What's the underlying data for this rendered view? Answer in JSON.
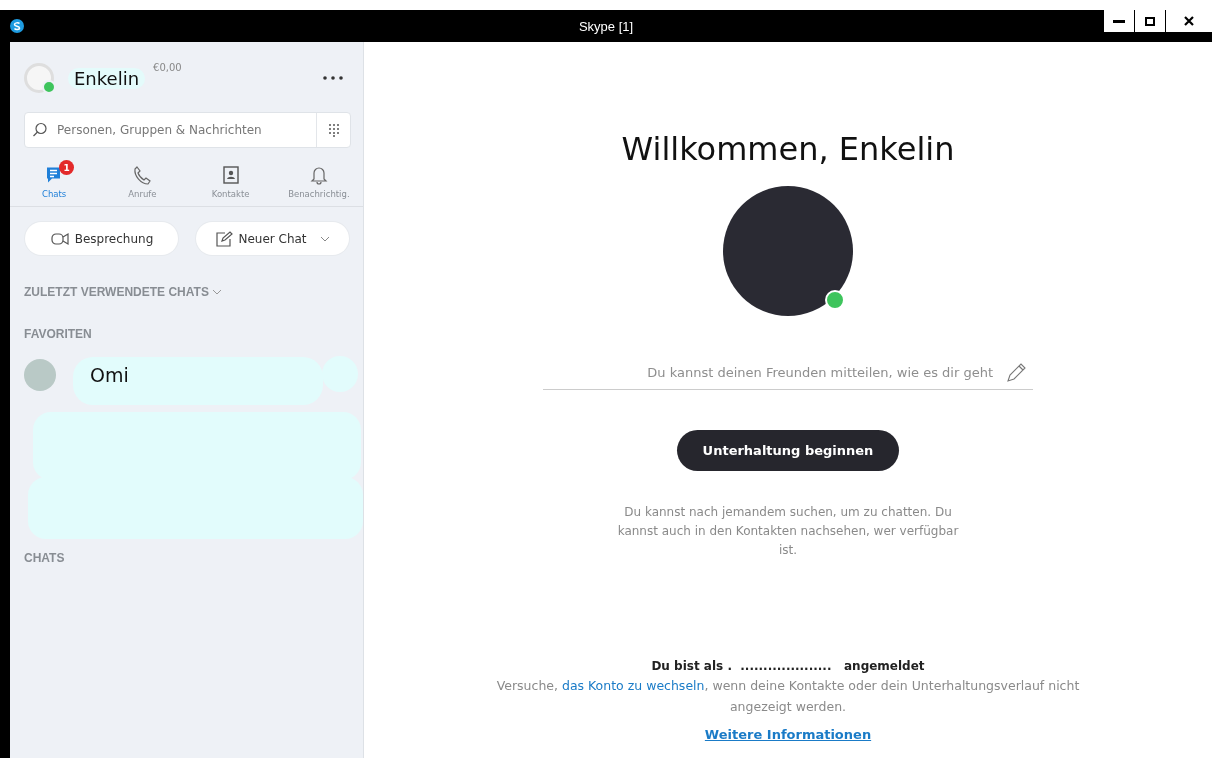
{
  "window": {
    "title": "Skype [1]"
  },
  "profile": {
    "name": "Enkelin",
    "credit": "€0,00",
    "online": true
  },
  "search": {
    "placeholder": "Personen, Gruppen & Nachrichten"
  },
  "tabs": [
    {
      "label": "Chats",
      "selected": true,
      "badge": "1"
    },
    {
      "label": "Anrufe",
      "selected": false
    },
    {
      "label": "Kontakte",
      "selected": false
    },
    {
      "label": "Benachrichtig.",
      "selected": false
    }
  ],
  "actions": [
    {
      "label": "Besprechung",
      "dropdown": false
    },
    {
      "label": "Neuer Chat",
      "dropdown": true
    }
  ],
  "sections": [
    {
      "title": "ZULETZT VERWENDETE CHATS",
      "expandable": true
    },
    {
      "title": "FAVORITEN",
      "expandable": false,
      "contacts": [
        {
          "name": "Omi"
        }
      ]
    },
    {
      "title": "CHATS",
      "expandable": false
    }
  ],
  "welcome": {
    "title": "Willkommen, Enkelin",
    "online": true,
    "mood_placeholder": "Du kannst deinen Freunden mitteilen, wie es dir geht",
    "button": "Unterhaltung beginnen",
    "hint": "Du kannst nach jemandem suchen, um zu chatten. Du kannst auch in den Kontakten nachsehen, wer verfügbar ist.",
    "signed_in": "Du bist als .  ....................   angemeldet",
    "switch_note": {
      "before": "Versuche, ",
      "link": "das Konto zu wechseln",
      "after": ", wenn deine Kontakte oder dein Unterhaltungsverlauf nicht angezeigt werden."
    },
    "more_link": "Weitere Informationen"
  }
}
